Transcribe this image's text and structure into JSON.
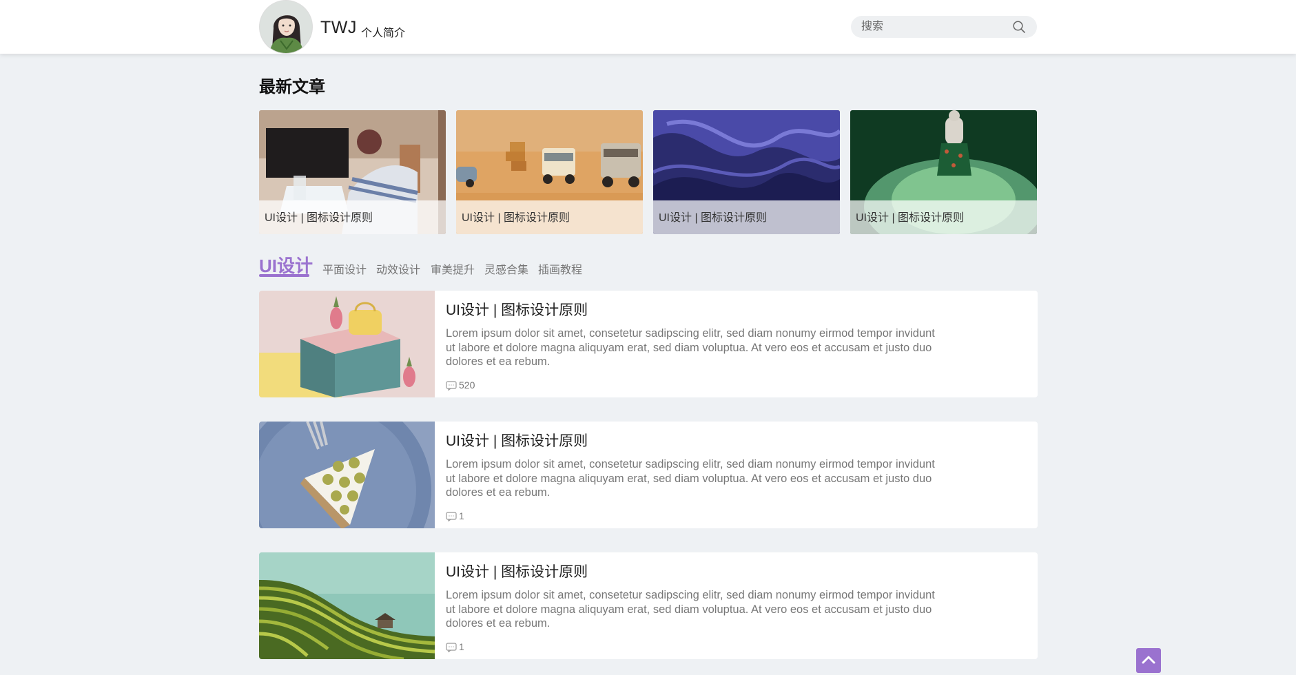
{
  "header": {
    "site_title": "TWJ",
    "about_link": "个人简介",
    "search_placeholder": "搜索"
  },
  "latest": {
    "title": "最新文章",
    "cards": [
      {
        "caption": "UI设计 | 图标设计原则"
      },
      {
        "caption": "UI设计 | 图标设计原则"
      },
      {
        "caption": "UI设计 | 图标设计原则"
      },
      {
        "caption": "UI设计 | 图标设计原则"
      }
    ]
  },
  "tabs": [
    {
      "label": "UI设计",
      "active": true
    },
    {
      "label": "平面设计"
    },
    {
      "label": "动效设计"
    },
    {
      "label": "审美提升"
    },
    {
      "label": "灵感合集"
    },
    {
      "label": "插画教程"
    }
  ],
  "articles": [
    {
      "title": "UI设计 | 图标设计原则",
      "excerpt": "Lorem ipsum dolor sit amet, consetetur sadipscing elitr, sed diam nonumy eirmod tempor invidunt ut labore et dolore magna aliquyam erat, sed diam voluptua. At vero eos et accusam et justo duo dolores et ea rebum.",
      "comments": "520"
    },
    {
      "title": "UI设计 | 图标设计原则",
      "excerpt": "Lorem ipsum dolor sit amet, consetetur sadipscing elitr, sed diam nonumy eirmod tempor invidunt ut labore et dolore magna aliquyam erat, sed diam voluptua. At vero eos et accusam et justo duo dolores et ea rebum.",
      "comments": "1"
    },
    {
      "title": "UI设计 | 图标设计原则",
      "excerpt": "Lorem ipsum dolor sit amet, consetetur sadipscing elitr, sed diam nonumy eirmod tempor invidunt ut labore et dolore magna aliquyam erat, sed diam voluptua. At vero eos et accusam et justo duo dolores et ea rebum.",
      "comments": "1"
    }
  ],
  "colors": {
    "accent": "#9a72cf",
    "background": "#eef1f4",
    "card": "#ffffff"
  },
  "icons": {
    "search": "search-icon",
    "comment": "comment-icon",
    "back_to_top": "chevron-up-icon"
  }
}
